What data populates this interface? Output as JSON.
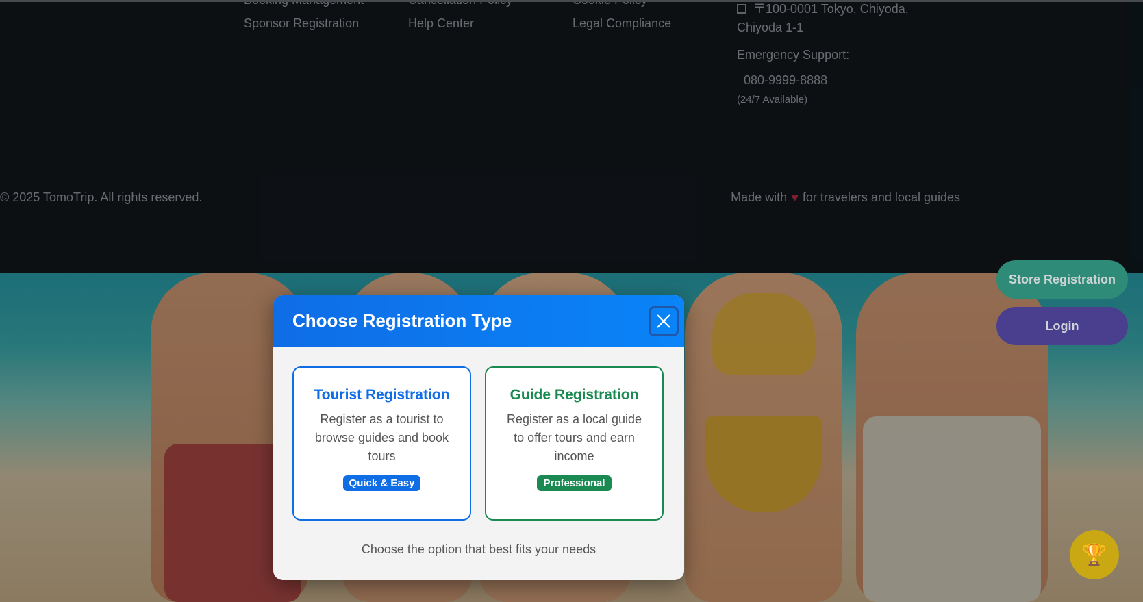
{
  "footer": {
    "col1_cut": "Booking Management",
    "col2_cut": "Cancellation Policy",
    "col3_cut": "Cookie Policy",
    "col1_link": "Sponsor Registration",
    "col2_link": "Help Center",
    "col3_link": "Legal Compliance",
    "address": "〒100-0001 Tokyo, Chiyoda, Chiyoda 1-1",
    "emergency_label": "Emergency Support:",
    "phone": "080-9999-8888",
    "availability": "(24/7 Available)",
    "copyright": "© 2025 TomoTrip. All rights reserved.",
    "made_prefix": "Made with",
    "made_suffix": "for travelers and local guides"
  },
  "side": {
    "store_label": "Store Registration",
    "login_label": "Login"
  },
  "modal": {
    "title": "Choose Registration Type",
    "tourist": {
      "title": "Tourist Registration",
      "desc": "Register as a tourist to browse guides and book tours",
      "badge": "Quick & Easy"
    },
    "guide": {
      "title": "Guide Registration",
      "desc": "Register as a local guide to offer tours and earn income",
      "badge": "Professional"
    },
    "footer_note": "Choose the option that best fits your needs"
  },
  "colors": {
    "primary": "#0f6de6",
    "guide_green": "#1b8a52",
    "footer_bg": "#13181d"
  },
  "icons": [
    "building-icon",
    "heart-icon",
    "close-icon",
    "trophy-icon"
  ]
}
